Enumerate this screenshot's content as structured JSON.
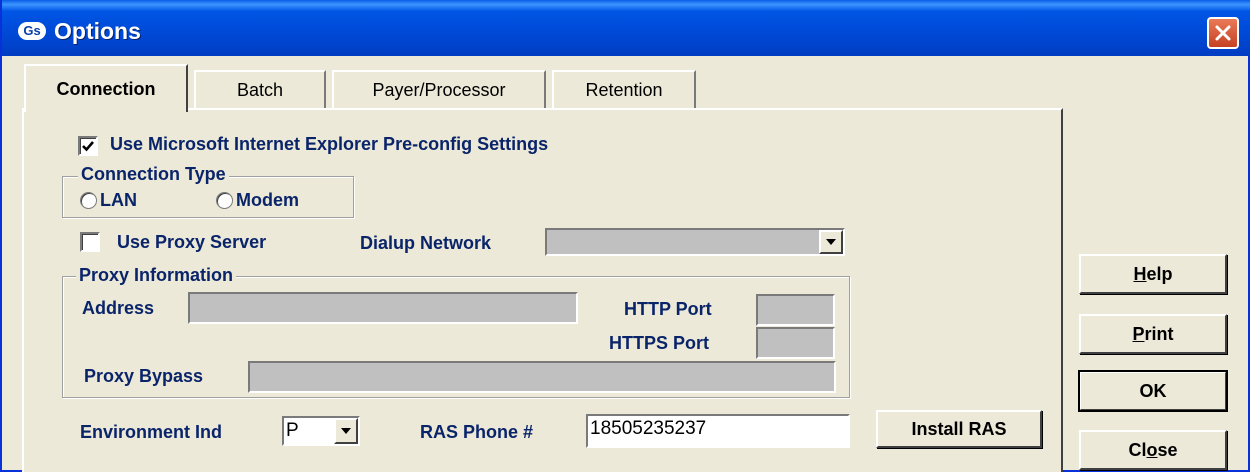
{
  "window": {
    "title": "Options",
    "app_icon_text": "Gs"
  },
  "tabs": [
    {
      "label": "Connection",
      "active": true
    },
    {
      "label": "Batch",
      "active": false
    },
    {
      "label": "Payer/Processor",
      "active": false
    },
    {
      "label": "Retention",
      "active": false
    }
  ],
  "connection": {
    "use_ie_settings_label": "Use Microsoft Internet Explorer Pre-config Settings",
    "use_ie_settings_checked": true,
    "connection_type_title": "Connection Type",
    "lan_label": "LAN",
    "modem_label": "Modem",
    "use_proxy_label": "Use Proxy Server",
    "use_proxy_checked": false,
    "dialup_network_label": "Dialup Network",
    "dialup_network_value": "",
    "proxy_info_title": "Proxy Information",
    "address_label": "Address",
    "address_value": "",
    "http_port_label": "HTTP Port",
    "http_port_value": "",
    "https_port_label": "HTTPS Port",
    "https_port_value": "",
    "proxy_bypass_label": "Proxy Bypass",
    "proxy_bypass_value": "",
    "environment_label": "Environment Ind",
    "environment_value": "P",
    "ras_phone_label": "RAS Phone #",
    "ras_phone_value": "18505235237",
    "install_ras_label": "Install RAS"
  },
  "buttons": {
    "help": {
      "label": "Help",
      "mnemonic_index": 0
    },
    "print": {
      "label": "Print",
      "mnemonic_index": 0
    },
    "ok": {
      "label": "OK"
    },
    "close": {
      "label": "Close",
      "mnemonic_index": 2
    }
  },
  "colors": {
    "title_bar": "#0055e5",
    "label_text": "#0a246a",
    "dialog_bg": "#ece9d8",
    "close_button": "#c64123"
  }
}
